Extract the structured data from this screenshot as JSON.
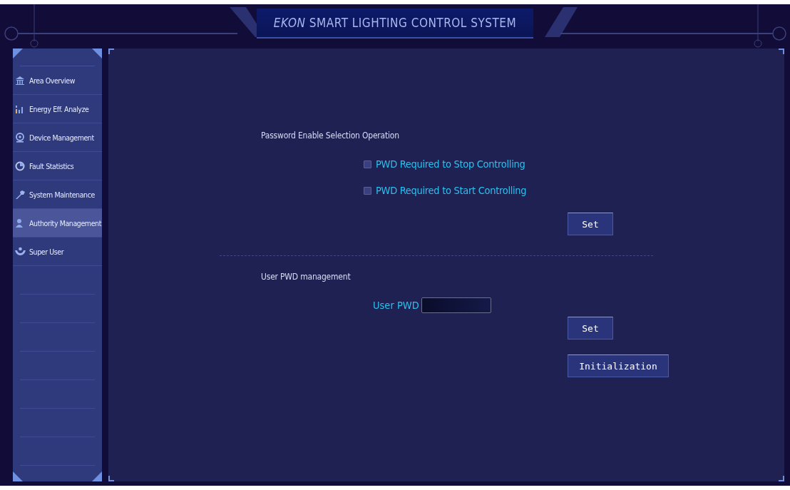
{
  "window": {
    "title": "*EKON* SMART LIGHTING CONTROL SYSTEM"
  },
  "sidebar": {
    "items": [
      {
        "label": "Area Overview",
        "selected": false
      },
      {
        "label": "Energy Eff. Analyze",
        "selected": false
      },
      {
        "label": "Device Management",
        "selected": false
      },
      {
        "label": "Fault Statistics",
        "selected": false
      },
      {
        "label": "System Maintenance",
        "selected": false
      },
      {
        "label": "Authority Management",
        "selected": true
      },
      {
        "label": "Super User",
        "selected": false
      }
    ]
  },
  "password_enable": {
    "heading": "Password Enable Selection Operation",
    "options": [
      {
        "label": "PWD Required to Stop Controlling",
        "checked": false
      },
      {
        "label": "PWD Required to Start Controlling",
        "checked": false
      }
    ],
    "button": "Set"
  },
  "user_pwd": {
    "heading": "User PWD management",
    "field_label": "User PWD",
    "buttons": [
      "Set",
      "Initialization"
    ]
  }
}
